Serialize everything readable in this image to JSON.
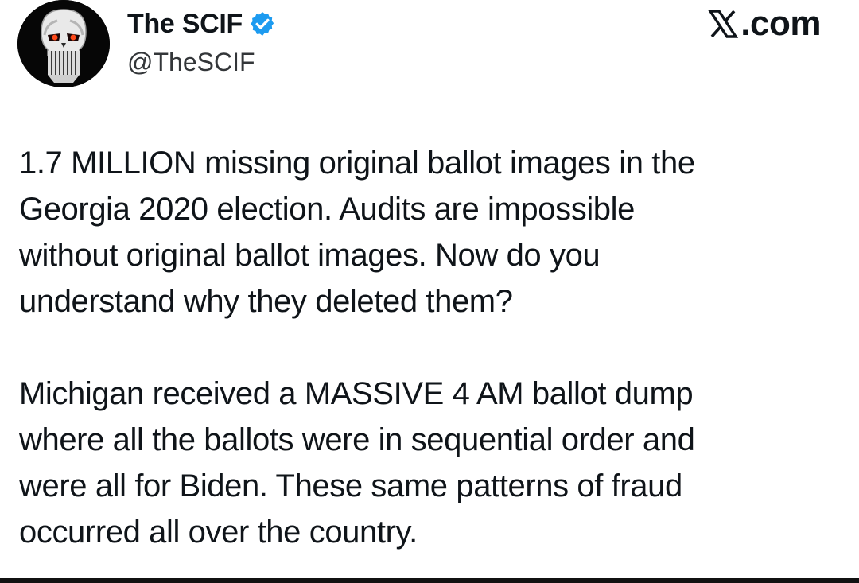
{
  "author": {
    "display_name": "The SCIF",
    "handle": "@TheSCIF",
    "verified": true,
    "avatar_icon": "punisher-skull-icon"
  },
  "brand": {
    "suffix": ".com",
    "icon": "x-logo-icon"
  },
  "tweet": {
    "paragraphs": [
      "1.7 MILLION missing original ballot images in the\nGeorgia 2020 election. Audits are impossible\nwithout original ballot images. Now do you\nunderstand why they deleted them?",
      "Michigan received a MASSIVE 4 AM ballot dump\nwhere all the ballots were in sequential order and\nwere all for Biden. These same patterns of fraud\noccurred all over the country."
    ]
  },
  "colors": {
    "verified_badge": "#1d9bf0",
    "text_primary": "#0f1419",
    "text_secondary": "#333639"
  }
}
